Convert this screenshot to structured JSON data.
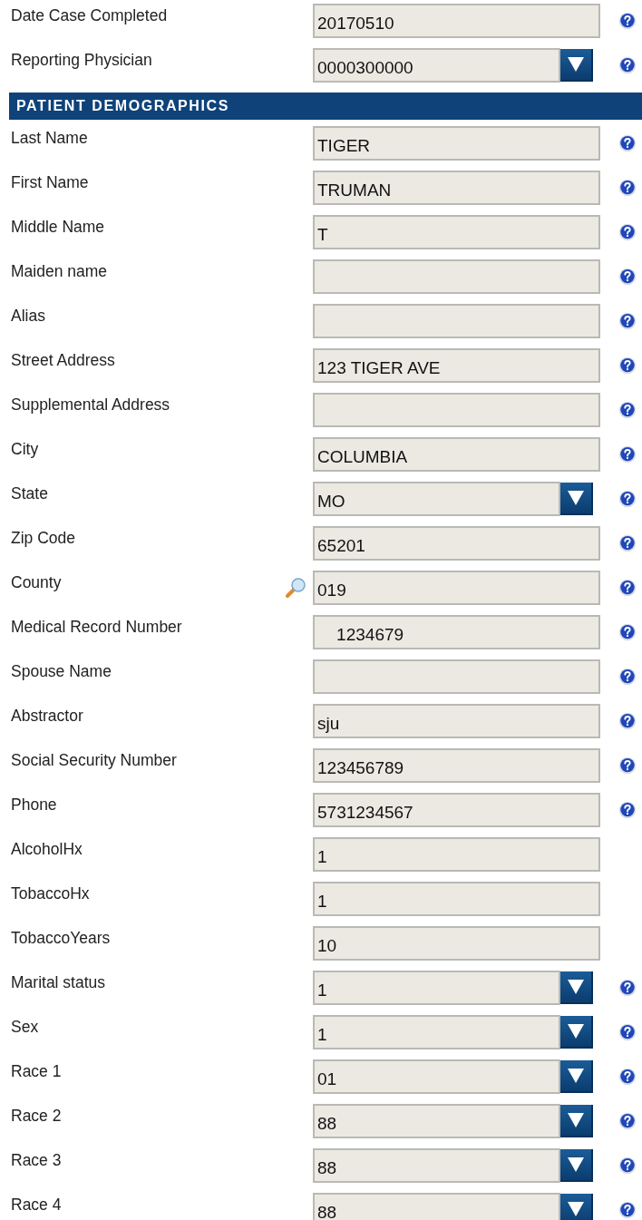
{
  "top_fields": [
    {
      "label": "Date Case Completed",
      "kind": "text",
      "value": "20170510",
      "help": true
    },
    {
      "label": "Reporting Physician",
      "kind": "select",
      "value": "0000300000",
      "help": true
    }
  ],
  "section": {
    "title": "PATIENT DEMOGRAPHICS"
  },
  "fields": [
    {
      "label": "Last Name",
      "kind": "text",
      "value": "TIGER",
      "help": true
    },
    {
      "label": "First Name",
      "kind": "text",
      "value": "TRUMAN",
      "help": true
    },
    {
      "label": "Middle Name",
      "kind": "text",
      "value": "T",
      "help": true
    },
    {
      "label": "Maiden name",
      "kind": "text",
      "help": true
    },
    {
      "label": "Alias",
      "kind": "text",
      "help": true
    },
    {
      "label": "Street Address",
      "kind": "text",
      "value": "123 TIGER AVE",
      "help": true
    },
    {
      "label": "Supplemental Address",
      "kind": "text",
      "help": true
    },
    {
      "label": "City",
      "kind": "text",
      "value": "COLUMBIA",
      "help": true
    },
    {
      "label": "State",
      "kind": "select",
      "value": "MO",
      "help": true
    },
    {
      "label": "Zip Code",
      "kind": "text",
      "value": "65201",
      "help": true
    },
    {
      "label": "County",
      "kind": "lookup",
      "value": "019",
      "help": true
    },
    {
      "label": "Medical Record Number",
      "kind": "text",
      "value": "    1234679",
      "help": true
    },
    {
      "label": "Spouse Name",
      "kind": "text",
      "help": true
    },
    {
      "label": "Abstractor",
      "kind": "text",
      "value": "sju",
      "help": true
    },
    {
      "label": "Social Security Number",
      "kind": "text",
      "value": "123456789",
      "help": true
    },
    {
      "label": "Phone",
      "kind": "text",
      "value": "5731234567",
      "help": true
    },
    {
      "label": "AlcoholHx",
      "kind": "text",
      "value": "1",
      "help": false
    },
    {
      "label": "TobaccoHx",
      "kind": "text",
      "value": "1",
      "help": false
    },
    {
      "label": "TobaccoYears",
      "kind": "text",
      "value": "10",
      "help": false
    },
    {
      "label": "Marital status",
      "kind": "select",
      "value": "1",
      "help": true
    },
    {
      "label": "Sex",
      "kind": "select",
      "value": "1",
      "help": true
    },
    {
      "label": "Race 1",
      "kind": "select",
      "value": "01",
      "help": true
    },
    {
      "label": "Race 2",
      "kind": "select",
      "value": "88",
      "help": true
    },
    {
      "label": "Race 3",
      "kind": "select",
      "value": "88",
      "help": true
    },
    {
      "label": "Race 4",
      "kind": "select",
      "value": "88",
      "help": true
    }
  ]
}
